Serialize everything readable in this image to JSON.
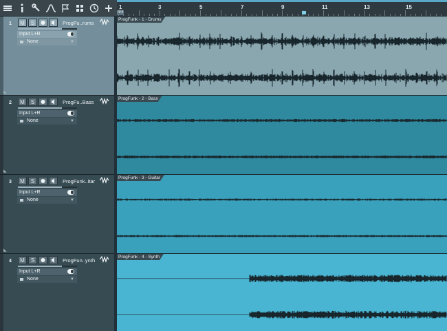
{
  "toolbar": {
    "icons": [
      "list-icon",
      "info-icon",
      "wrench-icon",
      "curve-icon",
      "flag-icon",
      "grid-icon",
      "clock-icon",
      "plus-icon"
    ]
  },
  "ruler": {
    "bars": [
      "1",
      "3",
      "5",
      "7",
      "9",
      "11",
      "13",
      "15"
    ],
    "time_signature": "4/4"
  },
  "tracks": [
    {
      "number": "1",
      "mute": "M",
      "solo": "S",
      "name": "ProgFu..rums",
      "input": "Input L+R",
      "output": "None",
      "clip": "ProgFunk - 1 - Drums",
      "color": "#8aa7b0"
    },
    {
      "number": "2",
      "mute": "M",
      "solo": "S",
      "name": "ProgFu..Bass",
      "input": "Input L+R",
      "output": "None",
      "clip": "ProgFunk - 2 - Bass",
      "color": "#2f8aa0"
    },
    {
      "number": "3",
      "mute": "M",
      "solo": "S",
      "name": "ProgFunk..itar",
      "input": "Input L+R",
      "output": "None",
      "clip": "ProgFunk - 3 - Guitar",
      "color": "#3aa1bd"
    },
    {
      "number": "4",
      "mute": "M",
      "solo": "S",
      "name": "ProgFun..ynth",
      "input": "Input L+R",
      "output": "None",
      "clip": "ProgFunk - 4 - Synth",
      "color": "#49b5d2"
    }
  ]
}
